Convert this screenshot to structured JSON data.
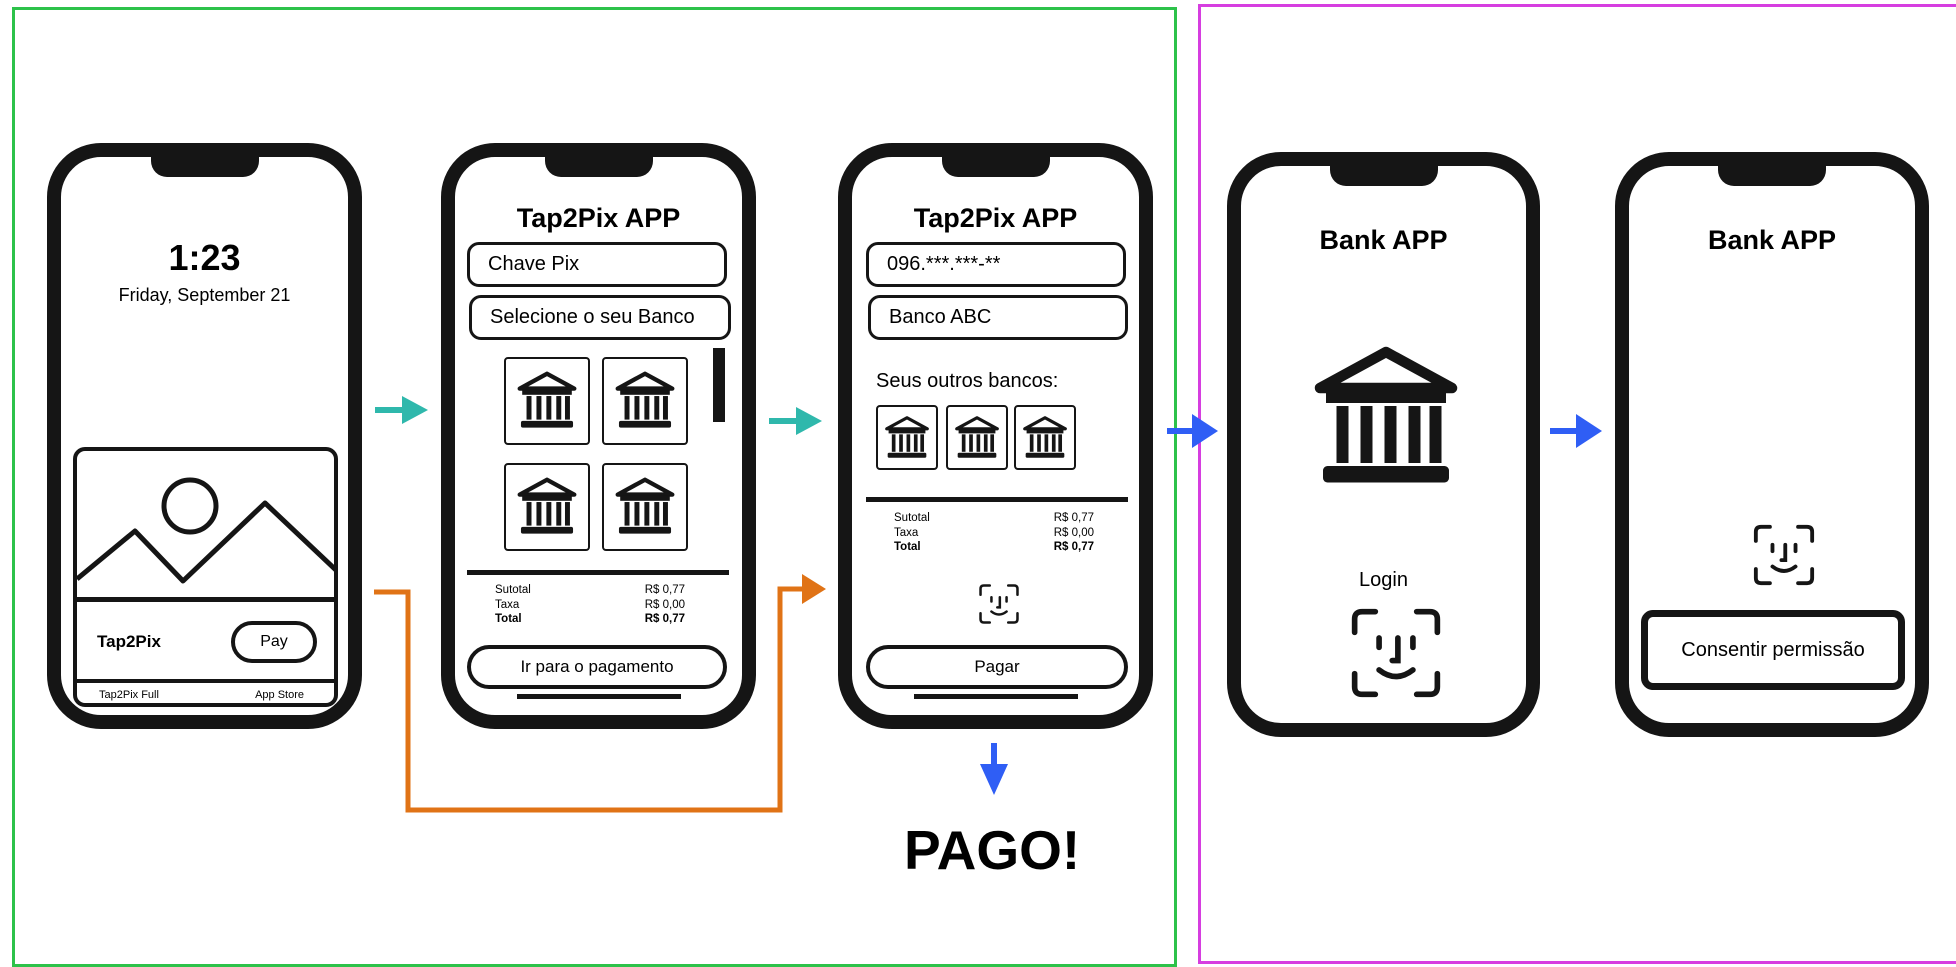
{
  "colors": {
    "teal_arrow": "#2fb8ac",
    "orange_path": "#e07316",
    "blue_arrow": "#2f5ef5",
    "green_panel": "#2dc24a",
    "magenta_panel": "#d63ee0",
    "ink": "#151515"
  },
  "lock_screen": {
    "time": "1:23",
    "date": "Friday, September 21",
    "card_app_name": "Tap2Pix",
    "pay_button": "Pay",
    "footer_left": "Tap2Pix Full",
    "footer_right": "App Store",
    "image_icon": "image-placeholder-icon"
  },
  "select_bank_screen": {
    "title": "Tap2Pix APP",
    "pix_key_field": "Chave Pix",
    "bank_select_field": "Selecione o seu Banco",
    "bank_icon": "bank-icon",
    "summary": {
      "subtotal_label": "Sutotal",
      "subtotal_value": "R$ 0,77",
      "fee_label": "Taxa",
      "fee_value": "R$ 0,00",
      "total_label": "Total",
      "total_value": "R$ 0,77"
    },
    "cta": "Ir para o pagamento"
  },
  "confirm_screen": {
    "title": "Tap2Pix APP",
    "pix_key_value": "096.***.***-**",
    "bank_value": "Banco ABC",
    "other_banks_label": "Seus outros bancos:",
    "summary": {
      "subtotal_label": "Sutotal",
      "subtotal_value": "R$ 0,77",
      "fee_label": "Taxa",
      "fee_value": "R$ 0,00",
      "total_label": "Total",
      "total_value": "R$ 0,77"
    },
    "faceid_icon": "face-id-icon",
    "cta": "Pagar"
  },
  "paid_label": "PAGO!",
  "bank_login_screen": {
    "title": "Bank APP",
    "bank_icon": "bank-icon",
    "login_label": "Login",
    "faceid_icon": "face-id-icon"
  },
  "bank_consent_screen": {
    "title": "Bank APP",
    "faceid_icon": "face-id-icon",
    "cta": "Consentir permissão"
  }
}
